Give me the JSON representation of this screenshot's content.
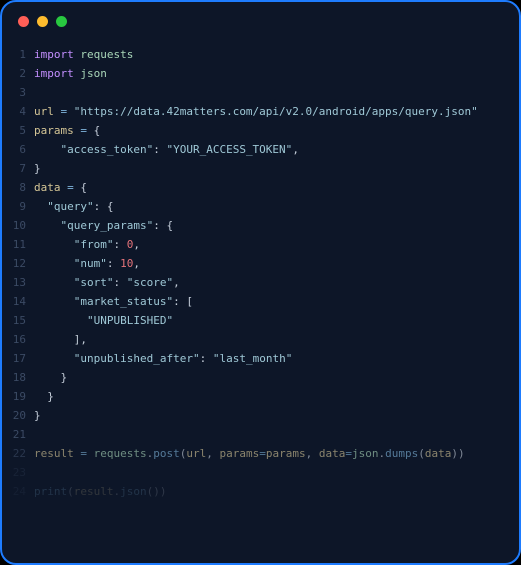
{
  "titlebar": {
    "dots": [
      "red",
      "yellow",
      "green"
    ]
  },
  "code": {
    "lines": [
      {
        "n": 1,
        "tokens": [
          {
            "t": "import",
            "c": "kw"
          },
          {
            "t": " "
          },
          {
            "t": "requests",
            "c": "mod"
          }
        ]
      },
      {
        "n": 2,
        "tokens": [
          {
            "t": "import",
            "c": "kw"
          },
          {
            "t": " "
          },
          {
            "t": "json",
            "c": "mod"
          }
        ]
      },
      {
        "n": 3,
        "tokens": []
      },
      {
        "n": 4,
        "tokens": [
          {
            "t": "url",
            "c": "var"
          },
          {
            "t": " "
          },
          {
            "t": "=",
            "c": "op"
          },
          {
            "t": " "
          },
          {
            "t": "\"https://data.42matters.com/api/v2.0/android/apps/query.json\"",
            "c": "str"
          }
        ]
      },
      {
        "n": 5,
        "tokens": [
          {
            "t": "params",
            "c": "var"
          },
          {
            "t": " "
          },
          {
            "t": "=",
            "c": "op"
          },
          {
            "t": " "
          },
          {
            "t": "{",
            "c": "punct"
          }
        ]
      },
      {
        "n": 6,
        "tokens": [
          {
            "t": "    "
          },
          {
            "t": "\"access_token\"",
            "c": "str"
          },
          {
            "t": ": ",
            "c": "punct"
          },
          {
            "t": "\"YOUR_ACCESS_TOKEN\"",
            "c": "str"
          },
          {
            "t": ",",
            "c": "punct"
          }
        ]
      },
      {
        "n": 7,
        "tokens": [
          {
            "t": "}",
            "c": "punct"
          }
        ]
      },
      {
        "n": 8,
        "tokens": [
          {
            "t": "data",
            "c": "var"
          },
          {
            "t": " "
          },
          {
            "t": "=",
            "c": "op"
          },
          {
            "t": " "
          },
          {
            "t": "{",
            "c": "punct"
          }
        ]
      },
      {
        "n": 9,
        "tokens": [
          {
            "t": "  "
          },
          {
            "t": "\"query\"",
            "c": "str"
          },
          {
            "t": ": ",
            "c": "punct"
          },
          {
            "t": "{",
            "c": "punct"
          }
        ]
      },
      {
        "n": 10,
        "tokens": [
          {
            "t": "    "
          },
          {
            "t": "\"query_params\"",
            "c": "str"
          },
          {
            "t": ": ",
            "c": "punct"
          },
          {
            "t": "{",
            "c": "punct"
          }
        ]
      },
      {
        "n": 11,
        "tokens": [
          {
            "t": "      "
          },
          {
            "t": "\"from\"",
            "c": "str"
          },
          {
            "t": ": ",
            "c": "punct"
          },
          {
            "t": "0",
            "c": "num"
          },
          {
            "t": ",",
            "c": "punct"
          }
        ]
      },
      {
        "n": 12,
        "tokens": [
          {
            "t": "      "
          },
          {
            "t": "\"num\"",
            "c": "str"
          },
          {
            "t": ": ",
            "c": "punct"
          },
          {
            "t": "10",
            "c": "num"
          },
          {
            "t": ",",
            "c": "punct"
          }
        ]
      },
      {
        "n": 13,
        "tokens": [
          {
            "t": "      "
          },
          {
            "t": "\"sort\"",
            "c": "str"
          },
          {
            "t": ": ",
            "c": "punct"
          },
          {
            "t": "\"score\"",
            "c": "str"
          },
          {
            "t": ",",
            "c": "punct"
          }
        ]
      },
      {
        "n": 14,
        "tokens": [
          {
            "t": "      "
          },
          {
            "t": "\"market_status\"",
            "c": "str"
          },
          {
            "t": ": ",
            "c": "punct"
          },
          {
            "t": "[",
            "c": "punct"
          }
        ]
      },
      {
        "n": 15,
        "tokens": [
          {
            "t": "        "
          },
          {
            "t": "\"UNPUBLISHED\"",
            "c": "str"
          }
        ]
      },
      {
        "n": 16,
        "tokens": [
          {
            "t": "      "
          },
          {
            "t": "],",
            "c": "punct"
          }
        ]
      },
      {
        "n": 17,
        "tokens": [
          {
            "t": "      "
          },
          {
            "t": "\"unpublished_after\"",
            "c": "str"
          },
          {
            "t": ": ",
            "c": "punct"
          },
          {
            "t": "\"last_month\"",
            "c": "str"
          }
        ]
      },
      {
        "n": 18,
        "tokens": [
          {
            "t": "    "
          },
          {
            "t": "}",
            "c": "punct"
          }
        ]
      },
      {
        "n": 19,
        "tokens": [
          {
            "t": "  "
          },
          {
            "t": "}",
            "c": "punct"
          }
        ]
      },
      {
        "n": 20,
        "tokens": [
          {
            "t": "}",
            "c": "punct"
          }
        ]
      },
      {
        "n": 21,
        "tokens": []
      },
      {
        "n": 22,
        "fade": "partial",
        "tokens": [
          {
            "t": "result",
            "c": "var"
          },
          {
            "t": " "
          },
          {
            "t": "=",
            "c": "op"
          },
          {
            "t": " "
          },
          {
            "t": "requests",
            "c": "mod"
          },
          {
            "t": ".",
            "c": "punct"
          },
          {
            "t": "post",
            "c": "fn"
          },
          {
            "t": "(",
            "c": "punct"
          },
          {
            "t": "url",
            "c": "var"
          },
          {
            "t": ", ",
            "c": "punct"
          },
          {
            "t": "params",
            "c": "var"
          },
          {
            "t": "=",
            "c": "op"
          },
          {
            "t": "params",
            "c": "var"
          },
          {
            "t": ", ",
            "c": "punct"
          },
          {
            "t": "data",
            "c": "var"
          },
          {
            "t": "=",
            "c": "op"
          },
          {
            "t": "json",
            "c": "mod"
          },
          {
            "t": ".",
            "c": "punct"
          },
          {
            "t": "dumps",
            "c": "fn"
          },
          {
            "t": "(",
            "c": "punct"
          },
          {
            "t": "data",
            "c": "var"
          },
          {
            "t": "))",
            "c": "punct"
          }
        ]
      },
      {
        "n": 23,
        "fade": "full",
        "tokens": []
      },
      {
        "n": 24,
        "fade": "full",
        "tokens": [
          {
            "t": "print",
            "c": "fn"
          },
          {
            "t": "(",
            "c": "punct"
          },
          {
            "t": "result",
            "c": "var"
          },
          {
            "t": ".",
            "c": "punct"
          },
          {
            "t": "json",
            "c": "fn"
          },
          {
            "t": "())",
            "c": "punct"
          }
        ]
      }
    ]
  }
}
